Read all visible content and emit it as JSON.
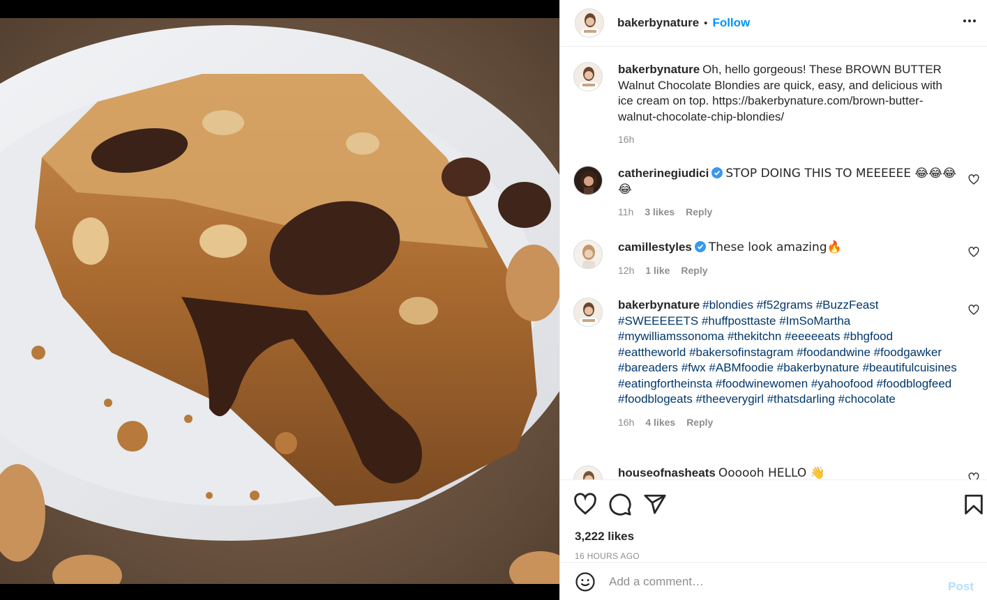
{
  "header": {
    "username": "bakerbynature",
    "dot": "•",
    "follow_label": "Follow"
  },
  "caption": {
    "username": "bakerbynature",
    "text": "Oh, hello gorgeous! These BROWN BUTTER Walnut Chocolate Blondies are quick, easy, and delicious with ice cream on top. https://bakerbynature.com/brown-butter-walnut-chocolate-chip-blondies/",
    "time": "16h"
  },
  "comments": [
    {
      "username": "catherinegiudici",
      "verified": true,
      "text": "STOP DOING THIS TO MEEEEEE 😂😂😂😂",
      "time": "11h",
      "likes": "3 likes",
      "reply": "Reply"
    },
    {
      "username": "camillestyles",
      "verified": true,
      "text": "These look amazing🔥",
      "time": "12h",
      "likes": "1 like",
      "reply": "Reply"
    },
    {
      "username": "bakerbynature",
      "verified": false,
      "tags": "#blondies #f52grams #BuzzFeast #SWEEEEETS #huffposttaste #ImSoMartha #mywilliamssonoma #thekitchn #eeeeeats #bhgfood #eattheworld #bakersofinstagram #foodandwine #foodgawker #bareaders #fwx #ABMfoodie #bakerbynature #beautifulcuisines #eatingfortheinsta #foodwinewomen #yahoofood #foodblogfeed #foodblogeats #theeverygirl #thatsdarling #chocolate",
      "time": "16h",
      "likes": "4 likes",
      "reply": "Reply"
    },
    {
      "username": "houseofnasheats",
      "text": "Oooooh HELLO 👋"
    }
  ],
  "actions": {
    "likes_count": "3,222 likes",
    "timestamp": "16 HOURS AGO",
    "icons": [
      "heart-icon",
      "comment-icon",
      "share-icon",
      "bookmark-icon"
    ]
  },
  "add_comment": {
    "placeholder": "Add a comment…",
    "post_label": "Post"
  },
  "colors": {
    "accent": "#0095f6",
    "hashtag": "#00376b",
    "muted": "#8e8e8e",
    "post_disabled": "#b2dffc"
  }
}
